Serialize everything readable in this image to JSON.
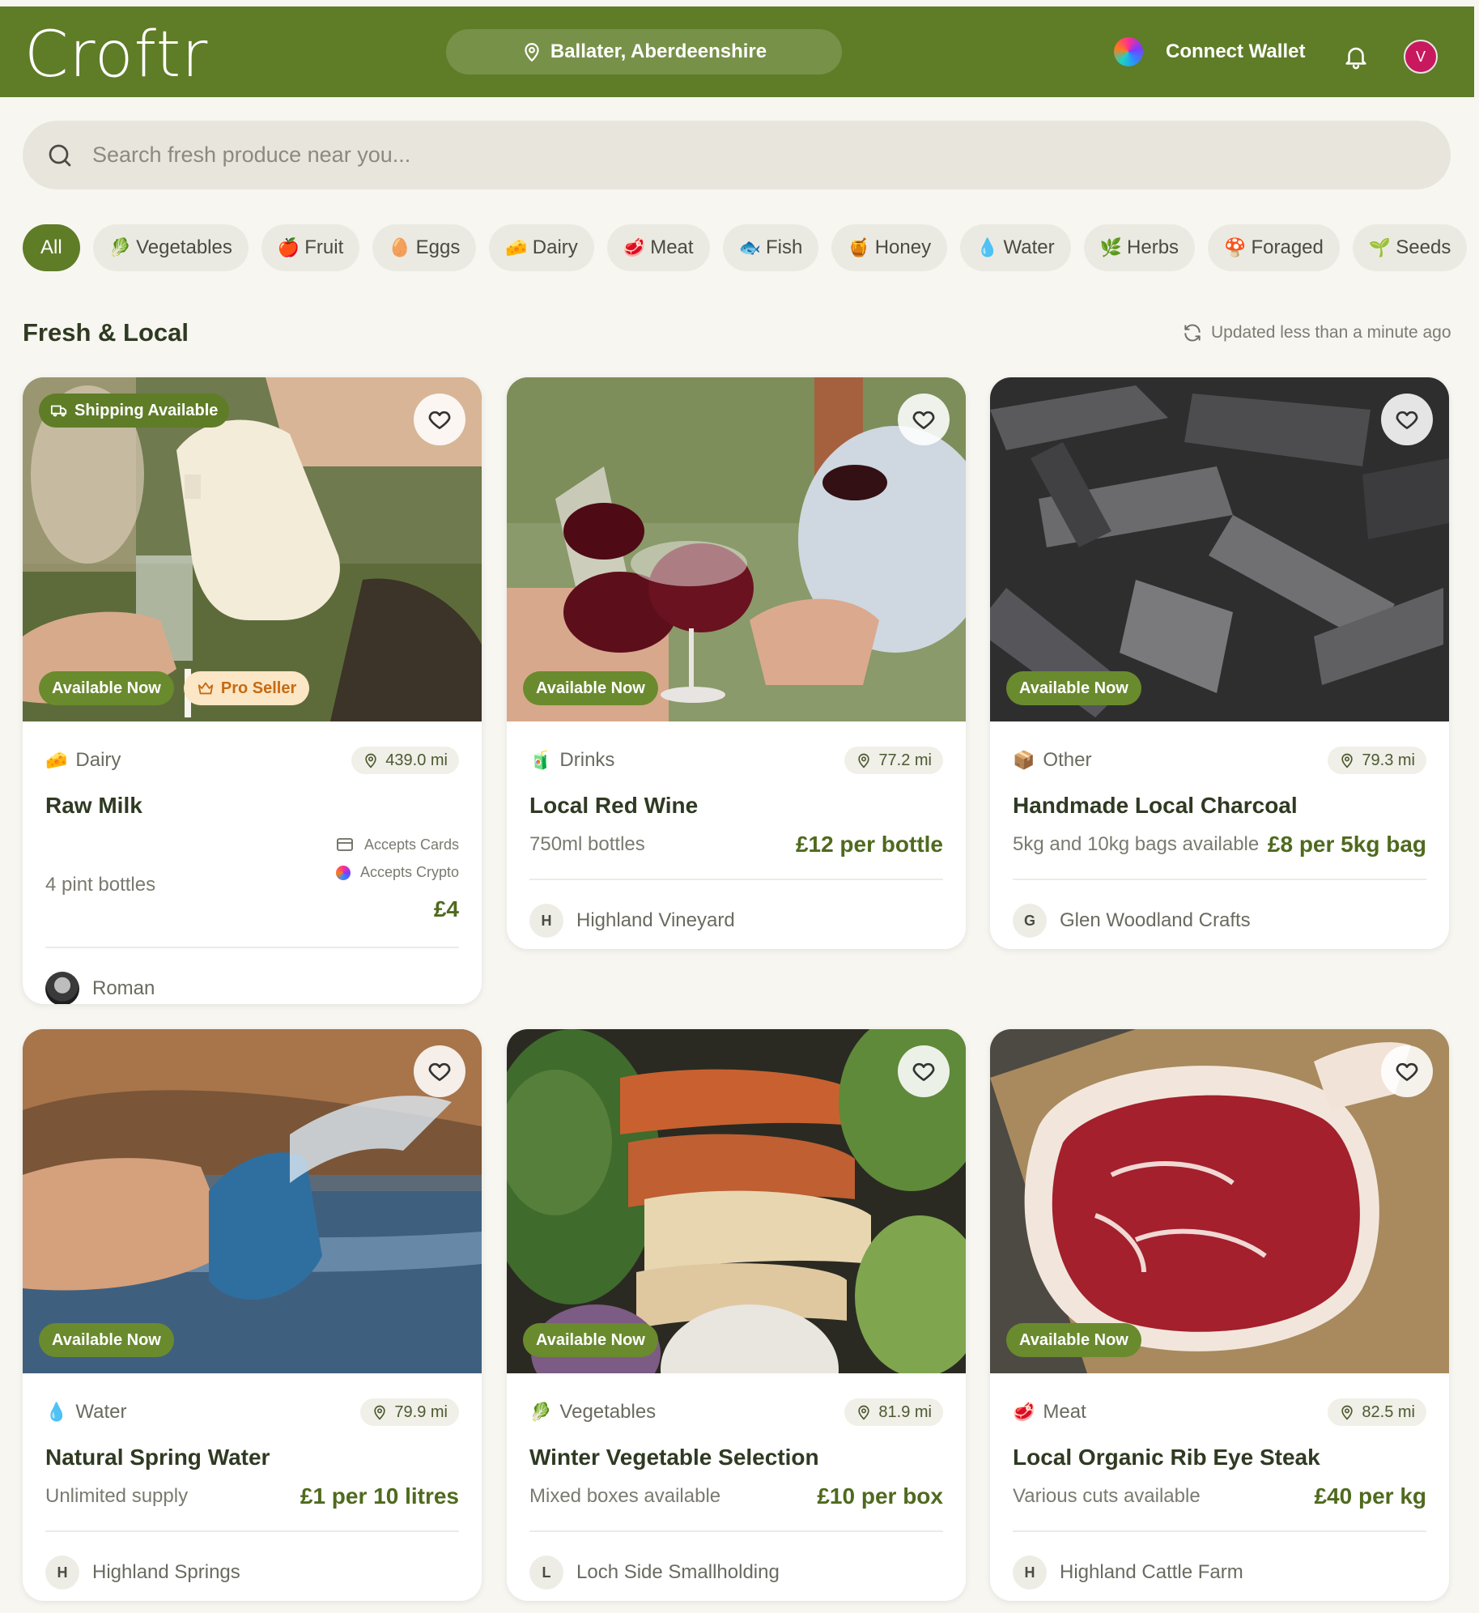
{
  "header": {
    "brand": "Croftr",
    "location": "Ballater, Aberdeenshire",
    "wallet_label": "Connect Wallet",
    "user_initial": "V"
  },
  "search": {
    "placeholder": "Search fresh produce near you..."
  },
  "categories": [
    {
      "label": "All",
      "emoji": ""
    },
    {
      "label": "Vegetables",
      "emoji": "🥬"
    },
    {
      "label": "Fruit",
      "emoji": "🍎"
    },
    {
      "label": "Eggs",
      "emoji": "🥚"
    },
    {
      "label": "Dairy",
      "emoji": "🧀"
    },
    {
      "label": "Meat",
      "emoji": "🥩"
    },
    {
      "label": "Fish",
      "emoji": "🐟"
    },
    {
      "label": "Honey",
      "emoji": "🍯"
    },
    {
      "label": "Water",
      "emoji": "💧"
    },
    {
      "label": "Herbs",
      "emoji": "🌿"
    },
    {
      "label": "Foraged",
      "emoji": "🍄"
    },
    {
      "label": "Seeds",
      "emoji": "🌱"
    }
  ],
  "section": {
    "title": "Fresh & Local",
    "updated": "Updated less than a minute ago"
  },
  "badges": {
    "shipping": "Shipping Available",
    "available": "Available Now",
    "pro": "Pro Seller",
    "accepts_cards": "Accepts Cards",
    "accepts_crypto": "Accepts Crypto"
  },
  "listings": [
    {
      "category": "Dairy",
      "emoji": "🧀",
      "distance": "439.0 mi",
      "title": "Raw Milk",
      "subtitle": "4 pint bottles",
      "price": "£4",
      "seller": "Roman",
      "seller_initial": ""
    },
    {
      "category": "Drinks",
      "emoji": "🧃",
      "distance": "77.2 mi",
      "title": "Local Red Wine",
      "subtitle": "750ml bottles",
      "price": "£12 per bottle",
      "seller": "Highland Vineyard",
      "seller_initial": "H"
    },
    {
      "category": "Other",
      "emoji": "📦",
      "distance": "79.3 mi",
      "title": "Handmade Local Charcoal",
      "subtitle": "5kg and 10kg bags available",
      "price": "£8 per 5kg bag",
      "seller": "Glen Woodland Crafts",
      "seller_initial": "G"
    },
    {
      "category": "Water",
      "emoji": "💧",
      "distance": "79.9 mi",
      "title": "Natural Spring Water",
      "subtitle": "Unlimited supply",
      "price": "£1 per 10 litres",
      "seller": "Highland Springs",
      "seller_initial": "H"
    },
    {
      "category": "Vegetables",
      "emoji": "🥬",
      "distance": "81.9 mi",
      "title": "Winter Vegetable Selection",
      "subtitle": "Mixed boxes available",
      "price": "£10 per box",
      "seller": "Loch Side Smallholding",
      "seller_initial": "L"
    },
    {
      "category": "Meat",
      "emoji": "🥩",
      "distance": "82.5 mi",
      "title": "Local Organic Rib Eye Steak",
      "subtitle": "Various cuts available",
      "price": "£40 per kg",
      "seller": "Highland Cattle Farm",
      "seller_initial": "H"
    }
  ],
  "colors": {
    "brand_green": "#5f7c27",
    "price_green": "#4f6a1e",
    "avatar_pink": "#c8195f",
    "pro_badge_bg": "#fbe6c6"
  }
}
